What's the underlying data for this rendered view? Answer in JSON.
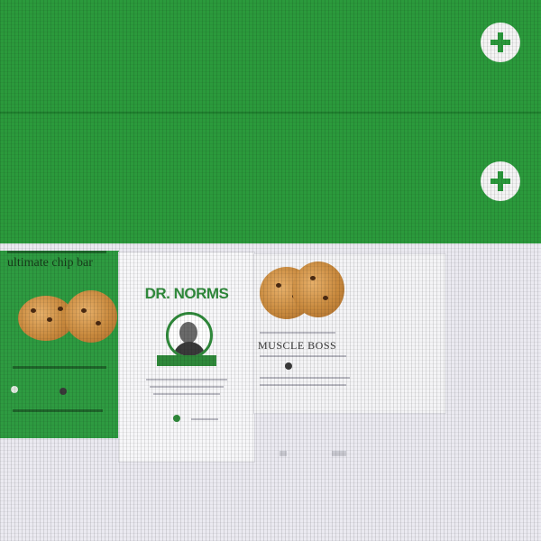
{
  "top_panel": {
    "color": "#2b9a3c",
    "buttons": [
      {
        "icon": "plus-circle-icon"
      },
      {
        "icon": "plus-circle-icon"
      }
    ]
  },
  "thumbnails": {
    "left": {
      "headline": "ultimate chip bar"
    },
    "card": {
      "brand": "DR. NORMS"
    },
    "right": {
      "title": "MUSCLE BOSS"
    }
  }
}
